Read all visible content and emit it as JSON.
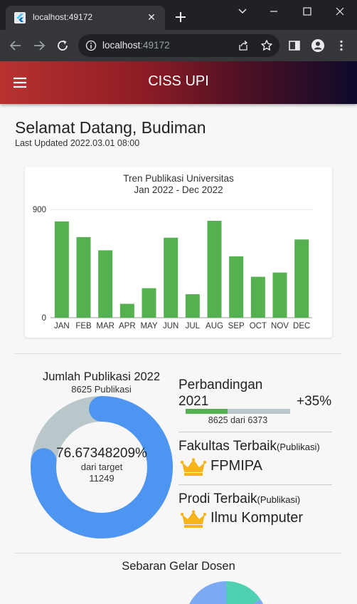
{
  "browser": {
    "tab_title": "localhost:49172",
    "url_host": "localhost",
    "url_port": ":49172"
  },
  "app": {
    "title": "CISS UPI"
  },
  "greeting": {
    "title": "Selamat Datang, Budiman",
    "updated": "Last Updated 2022.03.01 08:00"
  },
  "chart_data": {
    "type": "bar",
    "title": "Tren Publikasi Universitas",
    "subtitle": "Jan 2022 - Dec 2022",
    "categories": [
      "JAN",
      "FEB",
      "MAR",
      "APR",
      "MAY",
      "JUN",
      "JUL",
      "AUG",
      "SEP",
      "OCT",
      "NOV",
      "DEC"
    ],
    "values": [
      800,
      670,
      560,
      115,
      245,
      665,
      195,
      805,
      510,
      340,
      375,
      650
    ],
    "ylim": [
      0,
      900
    ],
    "yticks": [
      "0",
      "900"
    ],
    "color": "#55b150",
    "grid": true
  },
  "publikasi": {
    "title": "Jumlah Publikasi 2022",
    "subtitle": "8625 Publikasi",
    "percent_label": "76.67348209%",
    "target_label": "dari target",
    "target_value": "11249",
    "fraction": 0.7667,
    "colors": {
      "done": "#4e95f1",
      "rest": "#b9c7ca"
    }
  },
  "perbandingan": {
    "title": "Perbandingan 2021",
    "delta": "+35%",
    "detail": "8625 dari 6373",
    "fraction": 0.4
  },
  "fakultas": {
    "head": "Fakultas Terbaik",
    "head_unit": "(Publikasi)",
    "name": "FPMIPA",
    "icon": "crown-icon"
  },
  "prodi": {
    "head": "Prodi Terbaik",
    "head_unit": "(Publikasi)",
    "name": "Ilmu Komputer",
    "icon": "crown-icon"
  },
  "sebaran": {
    "title": "Sebaran Gelar Dosen"
  }
}
